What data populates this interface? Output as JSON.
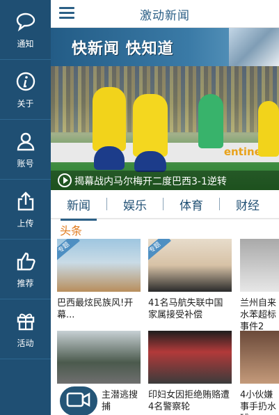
{
  "sidebar": {
    "items": [
      {
        "label": "通知",
        "icon": "chat-bubble-icon"
      },
      {
        "label": "关于",
        "icon": "info-icon"
      },
      {
        "label": "账号",
        "icon": "user-icon"
      },
      {
        "label": "上传",
        "icon": "upload-icon"
      },
      {
        "label": "推荐",
        "icon": "thumbs-up-icon"
      },
      {
        "label": "活动",
        "icon": "gift-icon"
      }
    ]
  },
  "header": {
    "title": "激动新闻"
  },
  "banner": {
    "text": "快新闻 快知道"
  },
  "hero": {
    "caption": "揭幕战内马尔梅开二度巴西3-1逆转",
    "ad_text": "entinel"
  },
  "tabs": [
    "新闻",
    "娱乐",
    "体育",
    "财经"
  ],
  "section": {
    "title": "头条"
  },
  "cards": [
    {
      "title": "巴西最炫民族风!开幕...",
      "tag": "专题"
    },
    {
      "title": "41名马航失联中国家属接受补偿",
      "tag": "专题"
    },
    {
      "title": "兰州自来水苯超标事件2",
      "tag": ""
    },
    {
      "title": "主潜逃搜捕",
      "tag": ""
    },
    {
      "title": "印妇女因拒绝贿赂遭4名警察轮",
      "tag": ""
    },
    {
      "title": "4小伙嫌事手扔水球",
      "tag": ""
    }
  ],
  "colors": {
    "sidebar": "#1f4f73",
    "accent": "#e07a1c",
    "brand": "#2b5f86"
  }
}
